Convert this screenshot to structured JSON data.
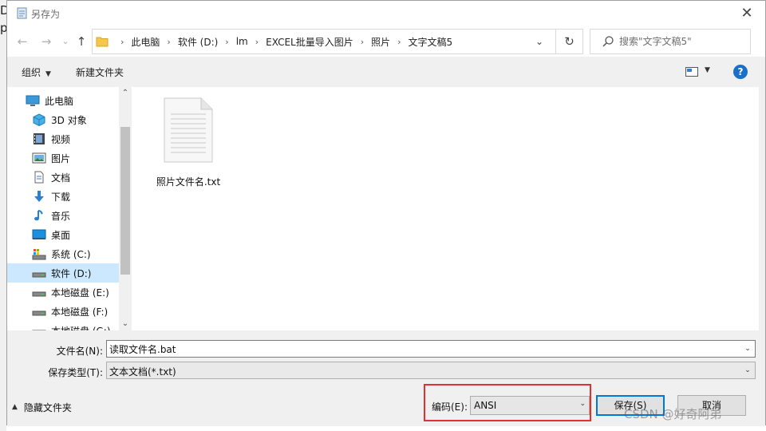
{
  "background": {
    "chars": [
      "D",
      "p"
    ]
  },
  "window": {
    "title": "另存为",
    "close_glyph": "✕"
  },
  "nav": {
    "back_glyph": "←",
    "forward_glyph": "→",
    "recent_glyph": "⌄",
    "up_glyph": "↑",
    "breadcrumbs": [
      "此电脑",
      "软件 (D:)",
      "lm",
      "EXCEL批量导入图片",
      "照片",
      "文字文稿5"
    ],
    "separator": "›",
    "dropdown_glyph": "⌄",
    "refresh_glyph": "↻",
    "search_placeholder": "搜索\"文字文稿5\""
  },
  "toolbar": {
    "organize_label": "组织",
    "new_folder_label": "新建文件夹",
    "help_label": "?",
    "dropdown_glyph": "▼"
  },
  "sidebar": {
    "items": [
      {
        "label": "此电脑",
        "icon": "computer-icon",
        "selected": false
      },
      {
        "label": "3D 对象",
        "icon": "3d-objects-icon",
        "selected": false
      },
      {
        "label": "视频",
        "icon": "video-icon",
        "selected": false
      },
      {
        "label": "图片",
        "icon": "pictures-icon",
        "selected": false
      },
      {
        "label": "文档",
        "icon": "documents-icon",
        "selected": false
      },
      {
        "label": "下载",
        "icon": "download-icon",
        "selected": false
      },
      {
        "label": "音乐",
        "icon": "music-icon",
        "selected": false
      },
      {
        "label": "桌面",
        "icon": "desktop-icon",
        "selected": false
      },
      {
        "label": "系统 (C:)",
        "icon": "system-drive-icon",
        "selected": false
      },
      {
        "label": "软件 (D:)",
        "icon": "drive-icon",
        "selected": true
      },
      {
        "label": "本地磁盘 (E:)",
        "icon": "drive-icon",
        "selected": false
      },
      {
        "label": "本地磁盘 (F:)",
        "icon": "drive-icon",
        "selected": false
      },
      {
        "label": "本地磁盘 (G:)",
        "icon": "drive-icon",
        "selected": false
      }
    ],
    "scroll_up_glyph": "⌃",
    "scroll_down_glyph": "⌄"
  },
  "files": [
    {
      "name": "照片文件名.txt",
      "icon": "text-file-icon"
    }
  ],
  "form": {
    "filename_label": "文件名(N):",
    "filename_value": "读取文件名.bat",
    "filetype_label": "保存类型(T):",
    "filetype_value": "文本文档(*.txt)",
    "encoding_label": "编码(E):",
    "encoding_value": "ANSI",
    "dropdown_glyph": "⌄"
  },
  "footer": {
    "hide_folders_label": "隐藏文件夹",
    "hide_folders_glyph": "▲",
    "save_label": "保存(S)",
    "cancel_label": "取消"
  },
  "watermark": "CSDN @好奇阿弟",
  "colors": {
    "highlight_border": "#e03030",
    "selected_bg": "#cce8ff",
    "accent": "#0078d7"
  }
}
